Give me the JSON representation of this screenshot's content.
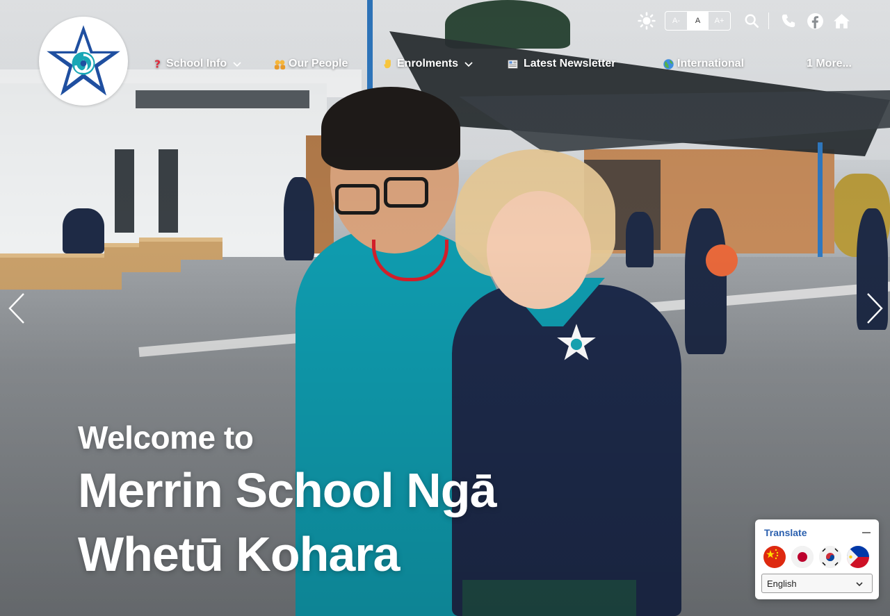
{
  "site": {
    "name": "Merrin School Ngā Whetū Kohara",
    "logo": "star-koru-logo",
    "colors": {
      "brand_blue": "#1f4fa0",
      "brand_teal": "#19a7b5",
      "white": "#ffffff"
    }
  },
  "utility_bar": {
    "theme_toggle_icon": "sun-icon",
    "font_sizes": [
      {
        "label": "A-",
        "active": false
      },
      {
        "label": "A",
        "active": true
      },
      {
        "label": "A+",
        "active": false
      }
    ],
    "search_icon": "search-icon",
    "phone_icon": "phone-icon",
    "facebook_icon": "facebook-icon",
    "home_icon": "home-icon"
  },
  "nav": {
    "items": [
      {
        "label": "School Info",
        "icon": "question-mark-emoji",
        "has_dropdown": true
      },
      {
        "label": "Our People",
        "icon": "people-emoji",
        "has_dropdown": false
      },
      {
        "label": "Enrolments",
        "icon": "waving-hand-emoji",
        "has_dropdown": true
      },
      {
        "label": "Latest Newsletter",
        "icon": "newspaper-emoji",
        "has_dropdown": false
      },
      {
        "label": "International",
        "icon": "globe-emoji",
        "has_dropdown": false
      },
      {
        "label": "1 More...",
        "icon": "",
        "has_dropdown": false
      }
    ]
  },
  "carousel": {
    "prev_icon": "chevron-left-icon",
    "next_icon": "chevron-right-icon"
  },
  "hero": {
    "welcome": "Welcome to",
    "title_line1": "Merrin School Ngā",
    "title_line2": "Whetū Kohara"
  },
  "translate_widget": {
    "title": "Translate",
    "minimize_icon": "minimize-icon",
    "flags": [
      "china-flag",
      "japan-flag",
      "south-korea-flag",
      "philippines-flag"
    ],
    "selected_language": "English"
  }
}
